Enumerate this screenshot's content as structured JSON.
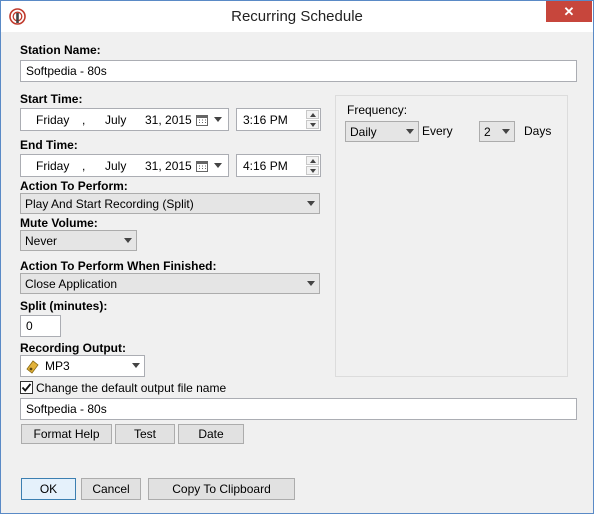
{
  "window": {
    "title": "Recurring Schedule",
    "close_glyph": "✕"
  },
  "station": {
    "label": "Station Name:",
    "value": "Softpedia - 80s"
  },
  "start_time": {
    "label": "Start Time:",
    "weekday": "Friday",
    "sep": ",",
    "month": "July",
    "day_year": "31, 2015",
    "time": "3:16 PM"
  },
  "end_time": {
    "label": "End Time:",
    "weekday": "Friday",
    "sep": ",",
    "month": "July",
    "day_year": "31, 2015",
    "time": "4:16 PM"
  },
  "action": {
    "label": "Action To Perform:",
    "value": "Play And Start Recording (Split)"
  },
  "mute": {
    "label": "Mute Volume:",
    "value": "Never"
  },
  "action_finished": {
    "label": "Action To Perform When Finished:",
    "value": "Close Application"
  },
  "split": {
    "label": "Split (minutes):",
    "value": "0"
  },
  "recording_output": {
    "label": "Recording Output:",
    "value": "MP3"
  },
  "change_name": {
    "label": "Change the default output file name",
    "checked": true
  },
  "output_name": {
    "value": "Softpedia - 80s"
  },
  "buttons": {
    "format_help": "Format Help",
    "test": "Test",
    "date": "Date"
  },
  "frequency": {
    "label": "Frequency:",
    "value": "Daily",
    "every_label": "Every",
    "every_value": "2",
    "unit": "Days"
  },
  "footer": {
    "ok": "OK",
    "cancel": "Cancel",
    "copy": "Copy To Clipboard"
  }
}
